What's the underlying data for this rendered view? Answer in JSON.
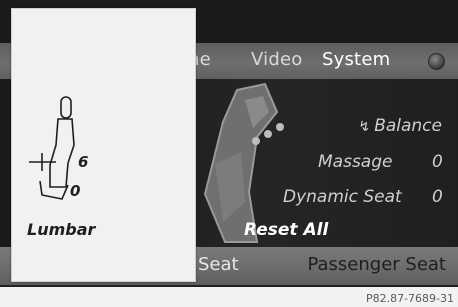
{
  "menu": {
    "phone_partial": "ne",
    "video": "Video",
    "system": "System"
  },
  "options": {
    "balance": "Balance",
    "massage": {
      "label": "Massage",
      "value": "0"
    },
    "dynamic_seat": {
      "label": "Dynamic Seat",
      "value": "0"
    },
    "reset_all": "Reset All"
  },
  "bottom_tabs": {
    "seat_partial": "Seat",
    "passenger": "Passenger Seat"
  },
  "lumbar_panel": {
    "value_upper": "6",
    "value_lower": "0",
    "label": "Lumbar"
  },
  "caption": "P82.87-7689-31",
  "icons": [
    "balance-icon",
    "status-dot-icon",
    "lumbar-seat-icon",
    "seat-graphic-icon"
  ],
  "colors": {
    "panel_bg": "#f1f1f1",
    "menubar_bg": "#6a6a6a",
    "screen_bg": "#1f1f1f"
  }
}
